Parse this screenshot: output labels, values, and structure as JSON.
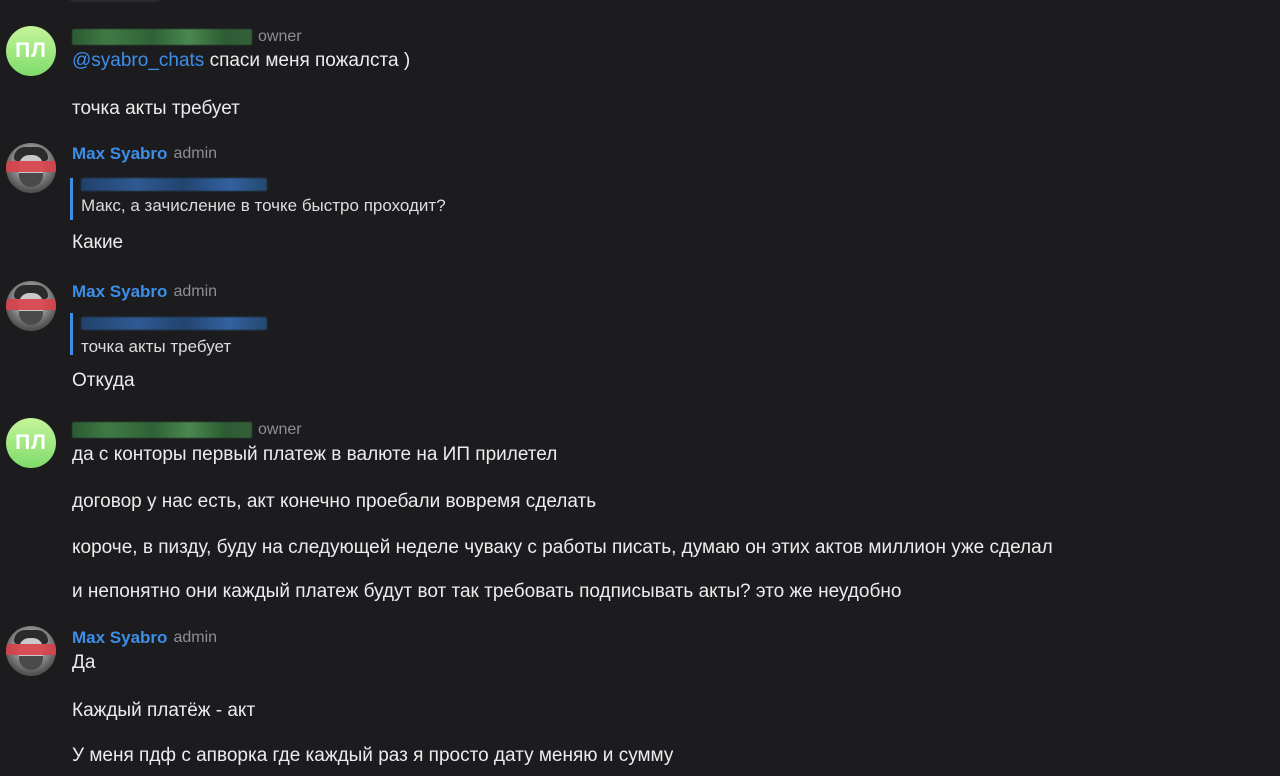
{
  "groups": [
    {
      "avatar_initials": "ПЛ",
      "role": "owner",
      "messages": [
        {
          "mention": "@syabro_chats",
          "text": " спаси меня пожалста )"
        },
        {
          "text": "точка акты требует"
        }
      ]
    },
    {
      "sender": "Max Syabro",
      "role": "admin",
      "reply_text": "Макс, а зачисление в точке быстро проходит?",
      "messages": [
        {
          "text": "Какие"
        }
      ]
    },
    {
      "sender": "Max Syabro",
      "role": "admin",
      "reply_text": "точка акты требует",
      "messages": [
        {
          "text": "Откуда"
        }
      ]
    },
    {
      "avatar_initials": "ПЛ",
      "role": "owner",
      "messages": [
        {
          "text": "да с конторы первый платеж в валюте на ИП прилетел"
        },
        {
          "text": "договор у нас есть, акт конечно проебали вовремя сделать"
        },
        {
          "text": "короче, в пизду, буду на следующей неделе чуваку с работы писать, думаю он этих актов миллион уже сделал"
        },
        {
          "text": "и непонятно они каждый платеж будут вот так требовать подписывать акты? это же неудобно"
        }
      ]
    },
    {
      "sender": "Max Syabro",
      "role": "admin",
      "messages": [
        {
          "text": "Да"
        },
        {
          "text": "Каждый платёж - акт"
        },
        {
          "text": "У меня пдф с апворка где каждый раз я просто дату меняю и сумму"
        }
      ]
    }
  ],
  "colors": {
    "background": "#1c1c1e",
    "accent": "#3d8ee8",
    "avatar_green": "#7fdc6a"
  }
}
